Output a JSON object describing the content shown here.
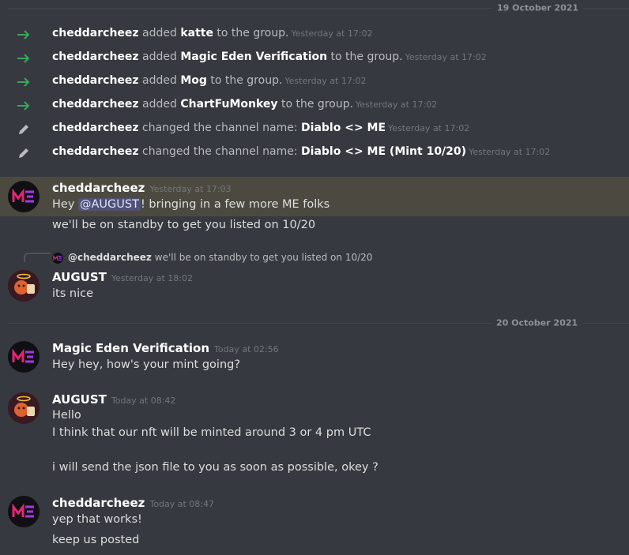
{
  "dividers": [
    {
      "label": "19 October 2021"
    },
    {
      "label": "20 October 2021"
    }
  ],
  "system_messages": [
    {
      "icon": "arrow-right-icon",
      "actor": "cheddarcheez",
      "verb": "added",
      "target": "katte",
      "suffix": "to the group.",
      "time": "Yesterday at 17:02"
    },
    {
      "icon": "arrow-right-icon",
      "actor": "cheddarcheez",
      "verb": "added",
      "target": "Magic Eden Verification",
      "suffix": "to the group.",
      "time": "Yesterday at 17:02"
    },
    {
      "icon": "arrow-right-icon",
      "actor": "cheddarcheez",
      "verb": "added",
      "target": "Mog",
      "suffix": "to the group.",
      "time": "Yesterday at 17:02"
    },
    {
      "icon": "arrow-right-icon",
      "actor": "cheddarcheez",
      "verb": "added",
      "target": "ChartFuMonkey",
      "suffix": "to the group.",
      "time": "Yesterday at 17:02"
    },
    {
      "icon": "pencil-icon",
      "actor": "cheddarcheez",
      "verb": "changed the channel name:",
      "target": "Diablo <> ME",
      "suffix": "",
      "time": "Yesterday at 17:02"
    },
    {
      "icon": "pencil-icon",
      "actor": "cheddarcheez",
      "verb": "changed the channel name:",
      "target": "Diablo <> ME (Mint 10/20)",
      "suffix": "",
      "time": "Yesterday at 17:02"
    }
  ],
  "messages": [
    {
      "user": "cheddarcheez",
      "time": "Yesterday at 17:03",
      "avatar": "me-logo",
      "lines_pre": "Hey ",
      "mention": "@AUGUST",
      "lines_post": "! bringing in a few more ME folks",
      "line2": "we'll be on standby to get you listed on 10/20"
    },
    {
      "user": "AUGUST",
      "time": "Yesterday at 18:02",
      "avatar": "august-avatar",
      "reply_user": "@cheddarcheez",
      "reply_text": "we'll be on standby to get you listed on 10/20",
      "line1": "its nice"
    },
    {
      "user": "Magic Eden Verification",
      "time": "Today at 02:56",
      "avatar": "me-logo",
      "line1": "Hey hey, how's your mint going?"
    },
    {
      "user": "AUGUST",
      "time": "Today at 08:42",
      "avatar": "august-avatar",
      "line1": "Hello",
      "line2": "I think that our nft will be minted around 3 or 4 pm UTC",
      "line3": "i will send the json file to you as soon as possible, okey ?"
    },
    {
      "user": "cheddarcheez",
      "time": "Today at 08:47",
      "avatar": "me-logo",
      "line1": "yep that works!",
      "line2": "keep us posted"
    }
  ],
  "colors": {
    "background": "#36393f",
    "highlight": "#4c4a40",
    "join_arrow": "#3ba55c",
    "mention_bg": "#5865f2"
  }
}
